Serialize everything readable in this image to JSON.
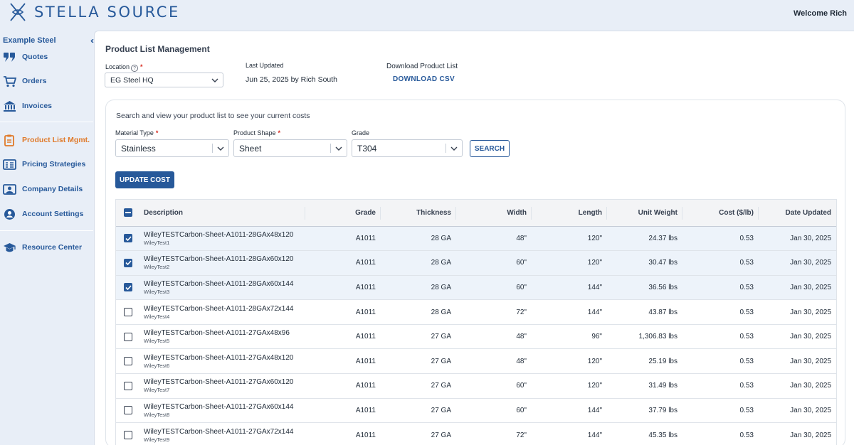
{
  "header": {
    "brand": "STELLA SOURCE",
    "welcome": "Welcome Rich"
  },
  "sidebar": {
    "org": "Example Steel",
    "items": [
      {
        "label": "Quotes",
        "icon": "quote-icon"
      },
      {
        "label": "Orders",
        "icon": "cart-icon"
      },
      {
        "label": "Invoices",
        "icon": "bank-icon"
      },
      {
        "label": "Product List Mgmt.",
        "icon": "clipboard-icon",
        "active": true
      },
      {
        "label": "Pricing Strategies",
        "icon": "pricing-icon"
      },
      {
        "label": "Company Details",
        "icon": "company-icon"
      },
      {
        "label": "Account Settings",
        "icon": "account-settings-icon"
      },
      {
        "label": "Resource Center",
        "icon": "graduation-cap-icon"
      }
    ]
  },
  "main": {
    "title": "Product List Management",
    "location_label": "Location",
    "location_value": "EG Steel HQ",
    "last_updated_label": "Last Updated",
    "last_updated_value": "Jun 25, 2025 by Rich South",
    "download_label": "Download Product List",
    "download_link": "DOWNLOAD CSV"
  },
  "search": {
    "description": "Search and view your product list to see your current costs",
    "material_label": "Material Type",
    "material_value": "Stainless",
    "shape_label": "Product Shape",
    "shape_value": "Sheet",
    "grade_label": "Grade",
    "grade_value": "T304",
    "search_button": "SEARCH",
    "update_button": "UPDATE COST"
  },
  "table": {
    "columns": [
      "Description",
      "Grade",
      "Thickness",
      "Width",
      "Length",
      "Unit Weight",
      "Cost ($/lb)",
      "Date Updated"
    ],
    "rows": [
      {
        "checked": true,
        "desc": "WileyTESTCarbon-Sheet-A1011-28GAx48x120",
        "sub": "WileyTest1",
        "grade": "A1011",
        "thickness": "28 GA",
        "width": "48\"",
        "length": "120\"",
        "weight": "24.37 lbs",
        "cost": "0.53",
        "date": "Jan 30, 2025"
      },
      {
        "checked": true,
        "desc": "WileyTESTCarbon-Sheet-A1011-28GAx60x120",
        "sub": "WileyTest2",
        "grade": "A1011",
        "thickness": "28 GA",
        "width": "60\"",
        "length": "120\"",
        "weight": "30.47 lbs",
        "cost": "0.53",
        "date": "Jan 30, 2025"
      },
      {
        "checked": true,
        "desc": "WileyTESTCarbon-Sheet-A1011-28GAx60x144",
        "sub": "WileyTest3",
        "grade": "A1011",
        "thickness": "28 GA",
        "width": "60\"",
        "length": "144\"",
        "weight": "36.56 lbs",
        "cost": "0.53",
        "date": "Jan 30, 2025"
      },
      {
        "checked": false,
        "desc": "WileyTESTCarbon-Sheet-A1011-28GAx72x144",
        "sub": "WileyTest4",
        "grade": "A1011",
        "thickness": "28 GA",
        "width": "72\"",
        "length": "144\"",
        "weight": "43.87 lbs",
        "cost": "0.53",
        "date": "Jan 30, 2025"
      },
      {
        "checked": false,
        "desc": "WileyTESTCarbon-Sheet-A1011-27GAx48x96",
        "sub": "WileyTest5",
        "grade": "A1011",
        "thickness": "27 GA",
        "width": "48\"",
        "length": "96\"",
        "weight": "1,306.83 lbs",
        "cost": "0.53",
        "date": "Jan 30, 2025"
      },
      {
        "checked": false,
        "desc": "WileyTESTCarbon-Sheet-A1011-27GAx48x120",
        "sub": "WileyTest6",
        "grade": "A1011",
        "thickness": "27 GA",
        "width": "48\"",
        "length": "120\"",
        "weight": "25.19 lbs",
        "cost": "0.53",
        "date": "Jan 30, 2025"
      },
      {
        "checked": false,
        "desc": "WileyTESTCarbon-Sheet-A1011-27GAx60x120",
        "sub": "WileyTest7",
        "grade": "A1011",
        "thickness": "27 GA",
        "width": "60\"",
        "length": "120\"",
        "weight": "31.49 lbs",
        "cost": "0.53",
        "date": "Jan 30, 2025"
      },
      {
        "checked": false,
        "desc": "WileyTESTCarbon-Sheet-A1011-27GAx60x144",
        "sub": "WileyTest8",
        "grade": "A1011",
        "thickness": "27 GA",
        "width": "60\"",
        "length": "144\"",
        "weight": "37.79 lbs",
        "cost": "0.53",
        "date": "Jan 30, 2025"
      },
      {
        "checked": false,
        "desc": "WileyTESTCarbon-Sheet-A1011-27GAx72x144",
        "sub": "WileyTest9",
        "grade": "A1011",
        "thickness": "27 GA",
        "width": "72\"",
        "length": "144\"",
        "weight": "45.35 lbs",
        "cost": "0.53",
        "date": "Jan 30, 2025"
      }
    ]
  },
  "colors": {
    "brand": "#27599a",
    "active": "#e07a2a",
    "required": "#d93025",
    "row_selected": "#edf3fa"
  }
}
